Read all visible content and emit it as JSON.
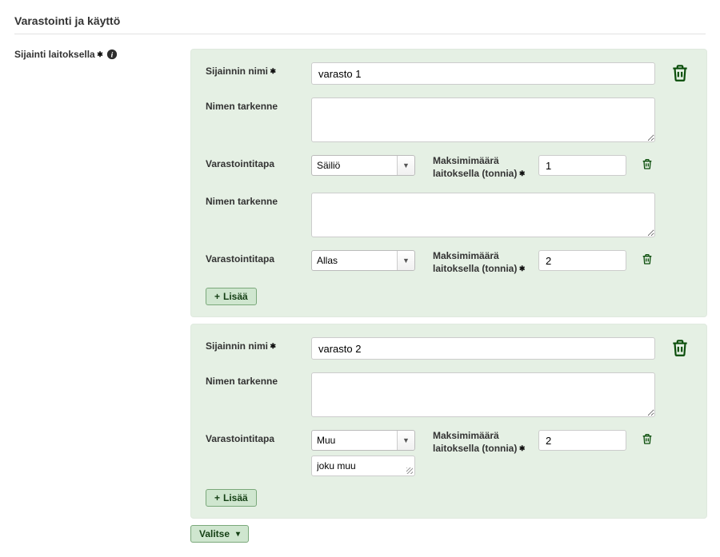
{
  "page_title": "Varastointi ja käyttö",
  "left_label": "Sijainti laitoksella",
  "labels": {
    "sijainnin_nimi": "Sijainnin nimi",
    "nimen_tarkenne": "Nimen tarkenne",
    "varastointitapa": "Varastointitapa",
    "maksimimaara": "Maksimimäärä laitoksella (tonnia)",
    "lisaa": "Lisää",
    "valitse": "Valitse"
  },
  "locations": [
    {
      "name": "varasto 1",
      "name_desc": "",
      "storages": [
        {
          "type": "Säiliö",
          "desc": "",
          "max": "1",
          "extra": null
        },
        {
          "type": "Allas",
          "desc": "",
          "max": "2",
          "extra": null
        }
      ]
    },
    {
      "name": "varasto 2",
      "name_desc": "",
      "storages": [
        {
          "type": "Muu",
          "desc": "",
          "max": "2",
          "extra": "joku muu"
        }
      ]
    }
  ],
  "storage_options": [
    "Säiliö",
    "Allas",
    "Muu"
  ]
}
